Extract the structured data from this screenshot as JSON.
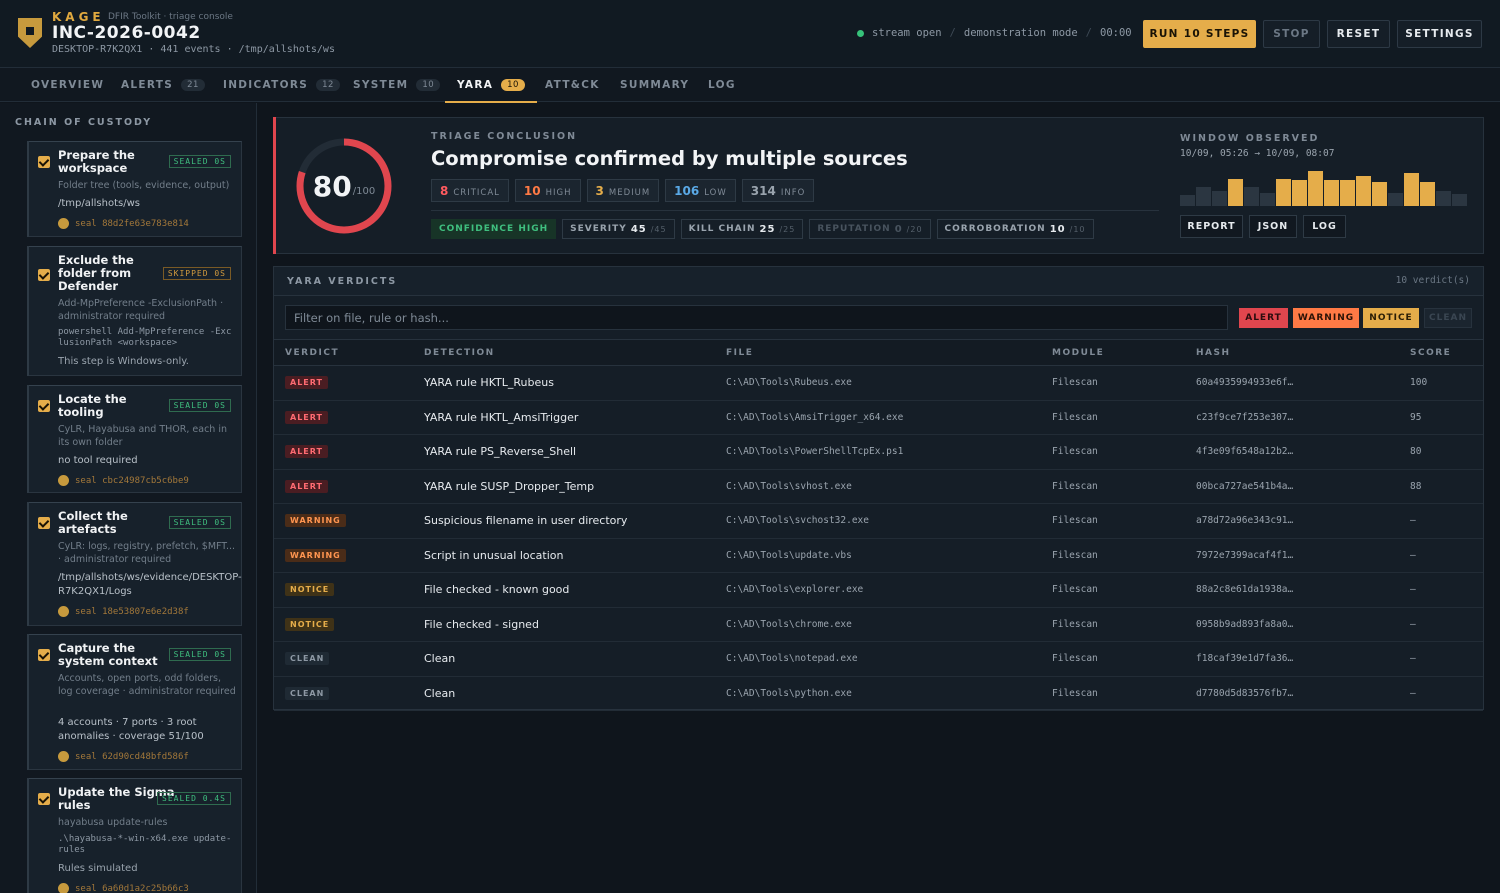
{
  "header": {
    "brand": "KAGE",
    "brand_sub": "DFIR Toolkit · triage console",
    "incident": "INC-2026-0042",
    "meta": "DESKTOP-R7K2QX1 · 441 events · /tmp/allshots/ws",
    "status": {
      "stream": "stream open",
      "mode": "demonstration mode",
      "timer": "00:00"
    },
    "buttons": {
      "run": "RUN 10 STEPS",
      "stop": "STOP",
      "reset": "RESET",
      "settings": "SETTINGS"
    }
  },
  "tabs": [
    {
      "label": "OVERVIEW",
      "count": ""
    },
    {
      "label": "ALERTS",
      "count": "21"
    },
    {
      "label": "INDICATORS",
      "count": "12"
    },
    {
      "label": "SYSTEM",
      "count": "10"
    },
    {
      "label": "YARA",
      "count": "10"
    },
    {
      "label": "ATT&CK",
      "count": ""
    },
    {
      "label": "SUMMARY",
      "count": ""
    },
    {
      "label": "LOG",
      "count": ""
    }
  ],
  "sidebar": {
    "title": "CHAIN OF CUSTODY",
    "steps": [
      {
        "title": "Prepare the workspace",
        "badge": "SEALED 0S",
        "desc": "Folder tree (tools, evidence, output)",
        "path": "/tmp/allshots/ws",
        "seal": "seal 88d2fe63e783e814"
      },
      {
        "title": "Exclude the folder from Defender",
        "badge": "SKIPPED 0S",
        "desc": "Add-MpPreference -ExclusionPath · administrator required",
        "code": "powershell Add-MpPreference -ExclusionPath <workspace>",
        "note": "This step is Windows-only."
      },
      {
        "title": "Locate the tooling",
        "badge": "SEALED 0S",
        "desc": "CyLR, Hayabusa and THOR, each in its own folder",
        "path": "no tool required",
        "seal": "seal cbc24987cb5c6be9"
      },
      {
        "title": "Collect the artefacts",
        "badge": "SEALED 0S",
        "desc": "CyLR: logs, registry, prefetch, $MFT... · administrator required",
        "path": "/tmp/allshots/ws/evidence/DESKTOP-R7K2QX1/Logs",
        "seal": "seal 18e53807e6e2d38f"
      },
      {
        "title": "Capture the system context",
        "badge": "SEALED 0S",
        "desc": "Accounts, open ports, odd folders, log coverage · administrator required",
        "path": "4 accounts · 7 ports · 3 root anomalies · coverage 51/100",
        "seal": "seal 62d90cd48bfd586f"
      },
      {
        "title": "Update the Sigma rules",
        "badge": "SEALED 0.4S",
        "desc": "hayabusa update-rules",
        "code": ".\\hayabusa-*-win-x64.exe update-rules",
        "note": "Rules simulated",
        "seal": "seal 6a60d1a2c25b66c3"
      }
    ]
  },
  "conclusion": {
    "score": "80",
    "score_max": "/100",
    "score_fraction": 0.8,
    "label": "TRIAGE CONCLUSION",
    "title": "Compromise confirmed by multiple sources",
    "severities": [
      {
        "n": "8",
        "label": "CRITICAL",
        "color": "#ff5a5f"
      },
      {
        "n": "10",
        "label": "HIGH",
        "color": "#ff7a45"
      },
      {
        "n": "3",
        "label": "MEDIUM",
        "color": "#e5ad4a"
      },
      {
        "n": "106",
        "label": "LOW",
        "color": "#5aa9e6"
      },
      {
        "n": "314",
        "label": "INFO",
        "color": "#9aa4ae"
      }
    ],
    "confidence": "CONFIDENCE HIGH",
    "factors": [
      {
        "label": "SEVERITY",
        "value": "45",
        "max": "/45"
      },
      {
        "label": "KILL CHAIN",
        "value": "25",
        "max": "/25"
      },
      {
        "label": "REPUTATION",
        "value": "0",
        "max": "/20"
      },
      {
        "label": "CORROBORATION",
        "value": "10",
        "max": "/10"
      }
    ],
    "window_label": "WINDOW OBSERVED",
    "window_range": "10/09, 05:26 → 10/09, 08:07",
    "histogram": [
      0.3,
      0.5,
      0.4,
      0.7,
      0.5,
      0.35,
      0.72,
      0.68,
      0.92,
      0.68,
      0.68,
      0.8,
      0.62,
      0.35,
      0.86,
      0.62,
      0.4,
      0.32
    ],
    "buttons": {
      "report": "REPORT",
      "json": "JSON",
      "log": "LOG"
    }
  },
  "verdicts": {
    "title": "YARA VERDICTS",
    "count": "10 verdict(s)",
    "filter_placeholder": "Filter on file, rule or hash...",
    "chips": [
      "ALERT",
      "WARNING",
      "NOTICE",
      "CLEAN"
    ],
    "columns": [
      "VERDICT",
      "DETECTION",
      "FILE",
      "MODULE",
      "HASH",
      "SCORE"
    ],
    "rows": [
      {
        "verdict": "ALERT",
        "detection": "YARA rule HKTL_Rubeus",
        "file": "C:\\AD\\Tools\\Rubeus.exe",
        "module": "Filescan",
        "hash": "60a4935994933e6f…",
        "score": "100"
      },
      {
        "verdict": "ALERT",
        "detection": "YARA rule HKTL_AmsiTrigger",
        "file": "C:\\AD\\Tools\\AmsiTrigger_x64.exe",
        "module": "Filescan",
        "hash": "c23f9ce7f253e307…",
        "score": "95"
      },
      {
        "verdict": "ALERT",
        "detection": "YARA rule PS_Reverse_Shell",
        "file": "C:\\AD\\Tools\\PowerShellTcpEx.ps1",
        "module": "Filescan",
        "hash": "4f3e09f6548a12b2…",
        "score": "80"
      },
      {
        "verdict": "ALERT",
        "detection": "YARA rule SUSP_Dropper_Temp",
        "file": "C:\\AD\\Tools\\svhost.exe",
        "module": "Filescan",
        "hash": "00bca727ae541b4a…",
        "score": "88"
      },
      {
        "verdict": "WARNING",
        "detection": "Suspicious filename in user directory",
        "file": "C:\\AD\\Tools\\svchost32.exe",
        "module": "Filescan",
        "hash": "a78d72a96e343c91…",
        "score": "—"
      },
      {
        "verdict": "WARNING",
        "detection": "Script in unusual location",
        "file": "C:\\AD\\Tools\\update.vbs",
        "module": "Filescan",
        "hash": "7972e7399acaf4f1…",
        "score": "—"
      },
      {
        "verdict": "NOTICE",
        "detection": "File checked - known good",
        "file": "C:\\AD\\Tools\\explorer.exe",
        "module": "Filescan",
        "hash": "88a2c8e61da1938a…",
        "score": "—"
      },
      {
        "verdict": "NOTICE",
        "detection": "File checked - signed",
        "file": "C:\\AD\\Tools\\chrome.exe",
        "module": "Filescan",
        "hash": "0958b9ad893fa8a0…",
        "score": "—"
      },
      {
        "verdict": "CLEAN",
        "detection": "Clean",
        "file": "C:\\AD\\Tools\\notepad.exe",
        "module": "Filescan",
        "hash": "f18caf39e1d7fa36…",
        "score": "—"
      },
      {
        "verdict": "CLEAN",
        "detection": "Clean",
        "file": "C:\\AD\\Tools\\python.exe",
        "module": "Filescan",
        "hash": "d7780d5d83576fb7…",
        "score": "—"
      }
    ]
  }
}
